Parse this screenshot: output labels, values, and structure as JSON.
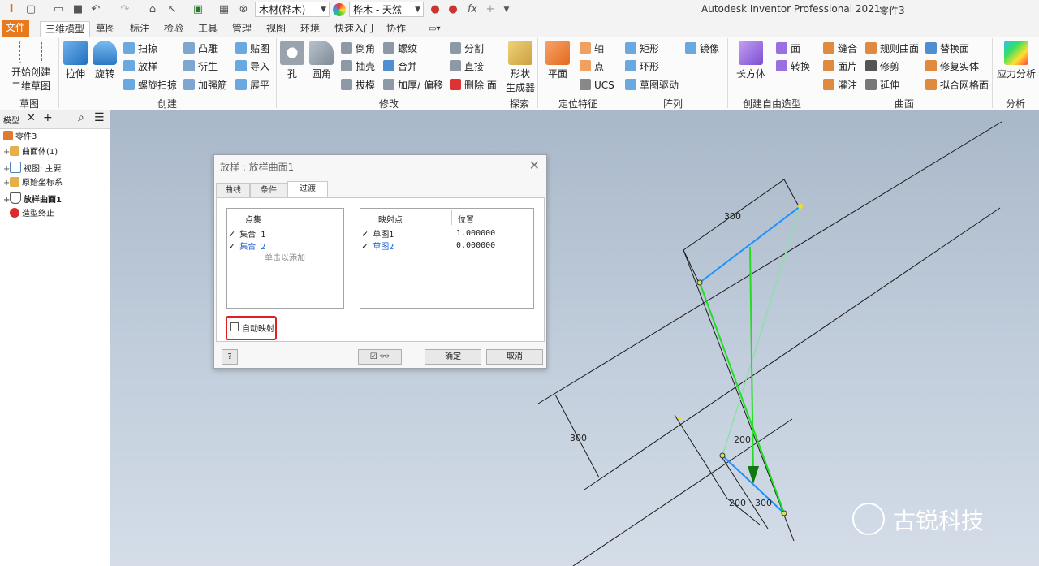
{
  "quick_access": {
    "material": "木材(桦木)",
    "appearance": "桦木 - 天然",
    "app_title": "Autodesk Inventor Professional 2021",
    "doc_name": "零件3"
  },
  "tabs": [
    "文件",
    "三维模型",
    "草图",
    "标注",
    "检验",
    "工具",
    "管理",
    "视图",
    "环境",
    "快速入门",
    "协作"
  ],
  "ribbon": {
    "sketch": {
      "label": "草图",
      "start": "开始创建",
      "start2": "二维草图"
    },
    "create": {
      "label": "创建",
      "extrude": "拉伸",
      "revolve": "旋转",
      "sweep": "扫掠",
      "loft": "放样",
      "coil": "螺旋扫掠",
      "emboss": "凸雕",
      "derive": "衍生",
      "rib": "加强筋",
      "decal": "贴图",
      "import": "导入",
      "unwrap": "展平"
    },
    "modify": {
      "label": "修改",
      "hole": "孔",
      "fillet": "圆角",
      "chamfer": "倒角",
      "shell": "抽壳",
      "draft": "拔模",
      "thread": "螺纹",
      "combine": "合并",
      "thicken": "加厚/ 偏移",
      "split": "分割",
      "direct": "直接",
      "delete_face": "删除 面"
    },
    "explore": {
      "label": "探索",
      "shape": "形状",
      "shape2": "生成器"
    },
    "work": {
      "label": "定位特征",
      "plane": "平面",
      "axis": "轴",
      "point": "点",
      "ucs": "UCS"
    },
    "pattern": {
      "label": "阵列",
      "rect": "矩形",
      "circ": "环形",
      "sketch_driven": "草图驱动",
      "mirror": "镜像"
    },
    "freeform": {
      "label": "创建自由造型",
      "box": "长方体",
      "face": "面",
      "convert": "转换"
    },
    "surface": {
      "label": "曲面",
      "stitch": "缝合",
      "patch": "面片",
      "sculpt": "灌注",
      "ruled": "规则曲面",
      "trim": "修剪",
      "extend": "延伸",
      "replace": "替换面",
      "repair": "修复实体",
      "fit": "拟合网格面"
    },
    "analysis": {
      "label": "分析",
      "stress": "应力分析"
    }
  },
  "browser": {
    "tab": "模型",
    "items": [
      "零件3",
      "曲面体(1)",
      "视图: 主要",
      "原始坐标系",
      "放样曲面1",
      "造型终止"
    ]
  },
  "dialog": {
    "title": "放样 : 放样曲面1",
    "tabs": [
      "曲线",
      "条件",
      "过渡"
    ],
    "points_header": "点集",
    "points": [
      "集合 1",
      "集合 2"
    ],
    "click_to_add": "单击以添加",
    "map_header": "映射点",
    "pos_header": "位置",
    "map_rows": [
      {
        "name": "草图1",
        "pos": "1.000000"
      },
      {
        "name": "草图2",
        "pos": "0.000000"
      }
    ],
    "auto_map": "自动映射",
    "ok": "确定",
    "cancel": "取消"
  },
  "dims": [
    "300",
    "300",
    "200",
    "200",
    "300"
  ],
  "watermark": "古锐科技"
}
